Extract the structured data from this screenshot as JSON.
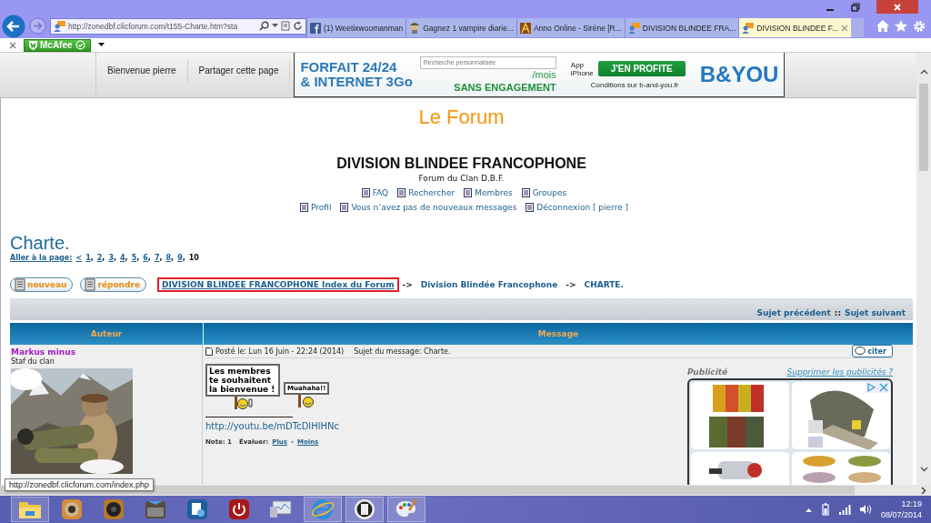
{
  "browser": {
    "address": "http://zonedbf.clicforum.com/t155-Charte.htm?sta",
    "tabs": [
      {
        "label": "(1) Weetixwoomanman",
        "kind": "social",
        "selected": false
      },
      {
        "label": "Gagnez 1 vampire diarie...",
        "kind": "avatar",
        "selected": false
      },
      {
        "label": "Anno Online - Sirène [R...",
        "kind": "game",
        "selected": false
      },
      {
        "label": "DIVISION BLINDEE FRA...",
        "kind": "forum",
        "selected": false
      },
      {
        "label": "DIVISION BLINDEE F...",
        "kind": "forum",
        "selected": true
      }
    ],
    "addon": "McAfee"
  },
  "forum_bar": {
    "welcome": "Bienvenue pierre",
    "share": "Partager cette page"
  },
  "banner": {
    "line_1": "FORFAIT 24/24",
    "line_2": "& INTERNET 3Go",
    "search_placeholder": "Recherche personnalisée",
    "per_month": "/mois",
    "no_commitment": "SANS ENGAGEMENT",
    "app": "App iPhone",
    "cta": "J'EN PROFITE",
    "conditions": "Conditions sur b-and-you.fr",
    "brand": "B&YOU"
  },
  "header": {
    "logo": "Le Forum",
    "title": "DIVISION BLINDEE FRANCOPHONE",
    "subtitle": "Forum du Clan D.B.F.",
    "nav_row_1": [
      {
        "label": "FAQ"
      },
      {
        "label": "Rechercher"
      },
      {
        "label": "Membres"
      },
      {
        "label": "Groupes"
      }
    ],
    "nav_row_2": [
      {
        "label": "Profil"
      },
      {
        "label": "Vous n’avez pas de nouveaux messages"
      },
      {
        "label": "Déconnexion [ pierre ]"
      }
    ]
  },
  "topic": {
    "title": "Charte.",
    "pagination": {
      "label": "Aller à la page:",
      "previous": "<",
      "separator": ",",
      "pages": [
        {
          "label": "1",
          "selected": false
        },
        {
          "label": "2",
          "selected": false
        },
        {
          "label": "3",
          "selected": false
        },
        {
          "label": "4",
          "selected": false
        },
        {
          "label": "5",
          "selected": false
        },
        {
          "label": "6",
          "selected": false
        },
        {
          "label": "7",
          "selected": false
        },
        {
          "label": "8",
          "selected": false
        },
        {
          "label": "9",
          "selected": false
        },
        {
          "label": "10",
          "selected": true
        }
      ]
    }
  },
  "actions": [
    "nouveau",
    "répondre"
  ],
  "breadcrumb": {
    "separator": "->",
    "items": [
      {
        "label": "DIVISION BLINDEE FRANCOPHONE Index du Forum",
        "highlighted": true
      },
      {
        "label": "Division Blindée Francophone",
        "highlighted": false
      },
      {
        "label": "CHARTE.",
        "highlighted": false
      }
    ]
  },
  "topic_nav": {
    "previous": "Sujet précédent",
    "separator": "::",
    "next": "Sujet suivant"
  },
  "table": {
    "columns": [
      "Auteur",
      "Message"
    ],
    "post": {
      "author": "Markus minus",
      "rank": "Staf du clan",
      "posted": "Posté le: Lun 16 Juin - 22:24 (2014)",
      "subject": "Sujet du message: Charte.",
      "quote": "citer",
      "signs": [
        "Les membres te souhaitent la bienvenue !",
        "Muahaha!!"
      ],
      "link": "http://youtu.be/mDTcDlHlHNc",
      "rating": {
        "note": "Note: 1",
        "label": "Évaluer:",
        "plus": "Plus",
        "separator": "-",
        "minus": "Moins"
      },
      "ad": {
        "label": "Publicité",
        "remove": "Supprimer les publicités ?"
      }
    }
  },
  "status_tooltip": "http://zonedbf.clicforum.com/index.php",
  "taskbar": {
    "apps": [
      {
        "kind": "folder",
        "running": true
      },
      {
        "kind": "camera",
        "running": false
      },
      {
        "kind": "speaker",
        "running": false
      },
      {
        "kind": "toolbox",
        "running": false
      },
      {
        "kind": "settings",
        "running": false
      },
      {
        "kind": "power",
        "running": false
      },
      {
        "kind": "monitor",
        "running": false
      },
      {
        "kind": "browser",
        "running": true
      },
      {
        "kind": "disk",
        "running": true
      },
      {
        "kind": "paint",
        "running": true
      }
    ],
    "time": "12:19",
    "date": "08/07/2014"
  }
}
